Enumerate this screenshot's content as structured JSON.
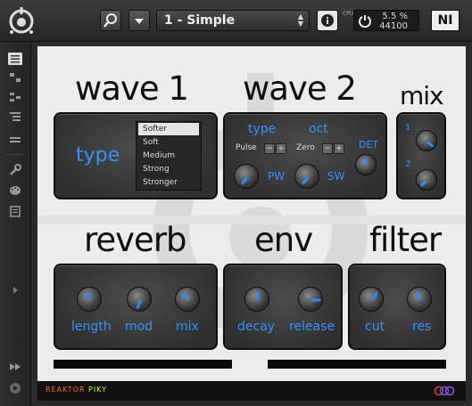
{
  "header": {
    "preset_name": "1 - Simple",
    "cpu_percent": "5.5 %",
    "sample_rate": "44100",
    "cpu_label": "CPU",
    "brand_badge": "NI"
  },
  "panels": {
    "wave1": {
      "title": "wave 1",
      "type_label": "type",
      "type_options": [
        "Softer",
        "Soft",
        "Medium",
        "Strong",
        "Stronger"
      ],
      "selected": "Softer"
    },
    "wave2": {
      "title": "wave 2",
      "type_label": "type",
      "oct_label": "oct",
      "type_value": "Pulse",
      "oct_value": "Zero",
      "det_label": "DET",
      "pw_label": "PW",
      "sw_label": "SW"
    },
    "mix": {
      "title": "mix",
      "ch1": "1",
      "ch2": "2"
    },
    "reverb": {
      "title": "reverb",
      "length_label": "length",
      "mod_label": "mod",
      "mix_label": "mix"
    },
    "env": {
      "title": "env",
      "decay_label": "decay",
      "release_label": "release"
    },
    "filter": {
      "title": "filter",
      "cut_label": "cut",
      "res_label": "res"
    }
  },
  "footer": {
    "brand1": "REAKTOR",
    "brand2": "PIKY"
  },
  "colors": {
    "accent": "#3a8eff",
    "panel": "#3a3a3a",
    "background": "#ececec"
  }
}
